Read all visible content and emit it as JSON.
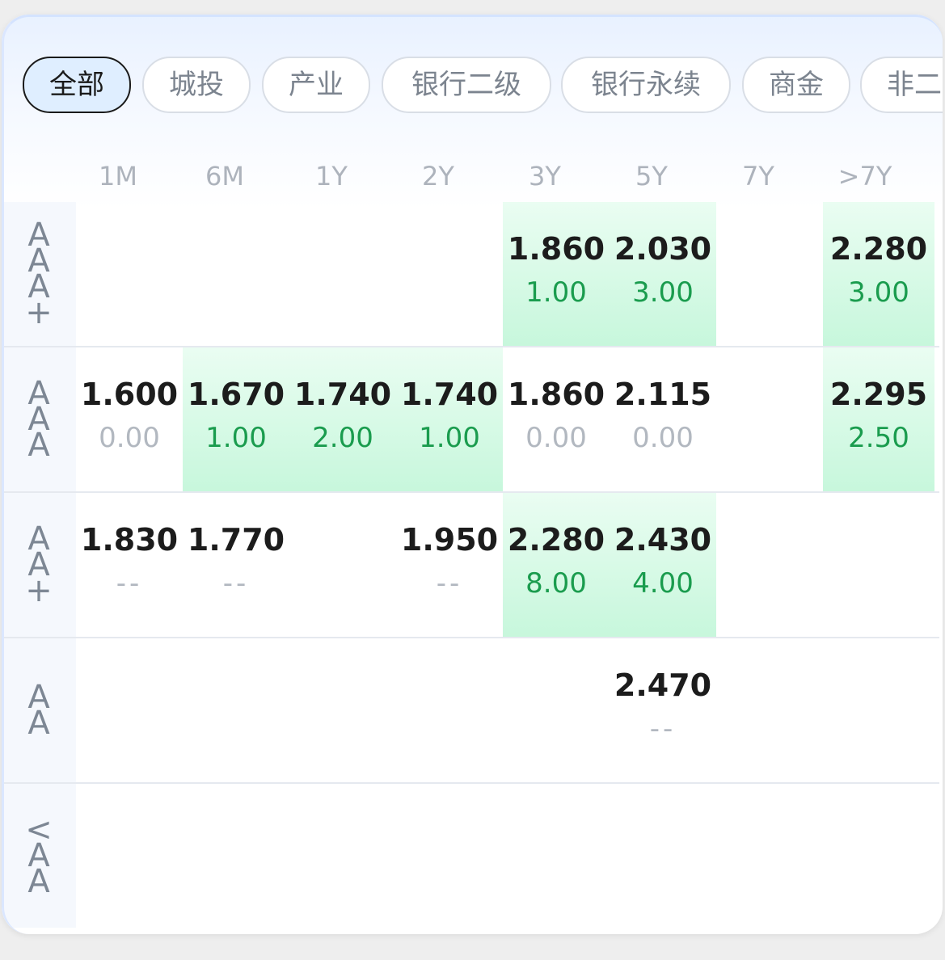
{
  "tabs": [
    {
      "label": "全部",
      "active": true
    },
    {
      "label": "城投",
      "active": false
    },
    {
      "label": "产业",
      "active": false
    },
    {
      "label": "银行二级",
      "active": false
    },
    {
      "label": "银行永续",
      "active": false
    },
    {
      "label": "商金",
      "active": false
    },
    {
      "label": "非二",
      "active": false
    }
  ],
  "columns": [
    "1M",
    "6M",
    "1Y",
    "2Y",
    "3Y",
    "5Y",
    "7Y",
    ">7Y"
  ],
  "rows": [
    {
      "label": "AAA+",
      "cells": [
        null,
        null,
        null,
        null,
        {
          "rate": "1.860",
          "volume": "1.00",
          "highlight": true
        },
        {
          "rate": "2.030",
          "volume": "3.00",
          "highlight": true
        },
        null,
        {
          "rate": "2.280",
          "volume": "3.00",
          "highlight": true
        }
      ]
    },
    {
      "label": "AAA",
      "cells": [
        {
          "rate": "1.600",
          "volume": "0.00",
          "highlight": false
        },
        {
          "rate": "1.670",
          "volume": "1.00",
          "highlight": true
        },
        {
          "rate": "1.740",
          "volume": "2.00",
          "highlight": true
        },
        {
          "rate": "1.740",
          "volume": "1.00",
          "highlight": true
        },
        {
          "rate": "1.860",
          "volume": "0.00",
          "highlight": false
        },
        {
          "rate": "2.115",
          "volume": "0.00",
          "highlight": false
        },
        null,
        {
          "rate": "2.295",
          "volume": "2.50",
          "highlight": true
        }
      ]
    },
    {
      "label": "AA+",
      "cells": [
        {
          "rate": "1.830",
          "volume": "--",
          "highlight": false
        },
        {
          "rate": "1.770",
          "volume": "--",
          "highlight": false
        },
        null,
        {
          "rate": "1.950",
          "volume": "--",
          "highlight": false
        },
        {
          "rate": "2.280",
          "volume": "8.00",
          "highlight": true
        },
        {
          "rate": "2.430",
          "volume": "4.00",
          "highlight": true
        },
        null,
        null
      ]
    },
    {
      "label": "AA",
      "cells": [
        null,
        null,
        null,
        null,
        null,
        {
          "rate": "2.470",
          "volume": "--",
          "highlight": false
        },
        null,
        null
      ]
    },
    {
      "label": "<AA",
      "cells": [
        null,
        null,
        null,
        null,
        null,
        null,
        null,
        null
      ]
    }
  ],
  "colors": {
    "accent_chip_bg": "#dfeeff",
    "highlight_cell": "#c7f7dc",
    "volume_green": "#1a9c4e",
    "muted_gray": "#b2b8c0"
  }
}
